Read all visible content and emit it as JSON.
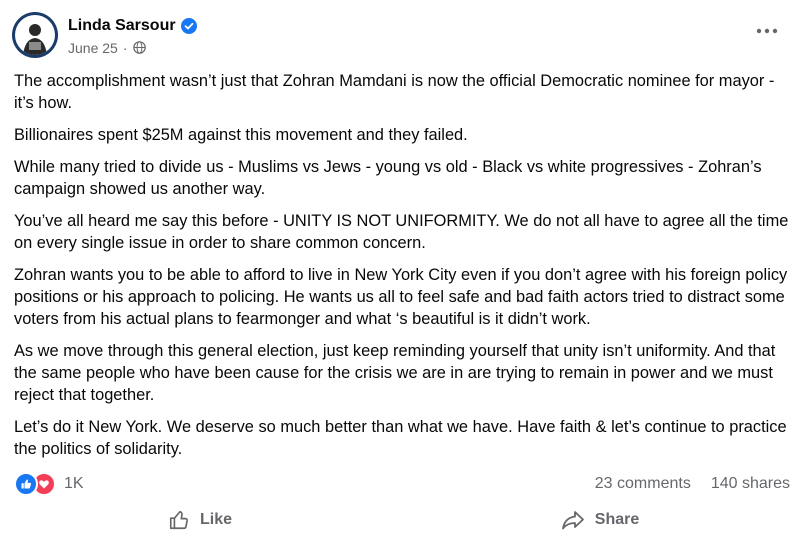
{
  "author": {
    "name": "Linda Sarsour",
    "date": "June 25"
  },
  "post": {
    "paragraphs": [
      "The accomplishment wasn’t just that Zohran Mamdani is now the official Democratic nominee for mayor - it’s how.",
      "Billionaires spent $25M against this movement and they failed.",
      "While many tried to divide us - Muslims vs Jews - young vs old - Black vs white progressives - Zohran’s campaign showed us another way.",
      "You’ve all heard me say this before - UNITY IS NOT UNIFORMITY. We do not all have to agree all the time on every single issue in order to share common concern.",
      "Zohran wants you to be able to afford to live in New York City even if you don’t agree with his foreign policy positions or his approach to policing. He wants us all to feel safe and bad faith actors tried to distract some voters from his actual plans to fearmonger and what ‘s beautiful is it didn’t work.",
      "As we move through this general election, just keep reminding yourself that unity isn’t uniformity. And that the same people who have been cause for the crisis we are in are trying to remain in power and we must reject that together.",
      "Let’s do it New York. We deserve so much better than what we have. Have faith & let’s continue to practice the politics of solidarity."
    ]
  },
  "stats": {
    "reactions": "1K",
    "comments": "23 comments",
    "shares": "140 shares"
  },
  "actions": {
    "like": "Like",
    "share": "Share"
  },
  "icons": [
    "verified-icon",
    "globe-icon",
    "more-options-icon",
    "like-reaction-icon",
    "love-reaction-icon",
    "thumbs-up-icon",
    "share-arrow-icon"
  ],
  "colors": {
    "brand": "#1877f2",
    "love": "#f33e58",
    "secondary_text": "#65676b",
    "avatar_ring": "#1b3b6b"
  }
}
